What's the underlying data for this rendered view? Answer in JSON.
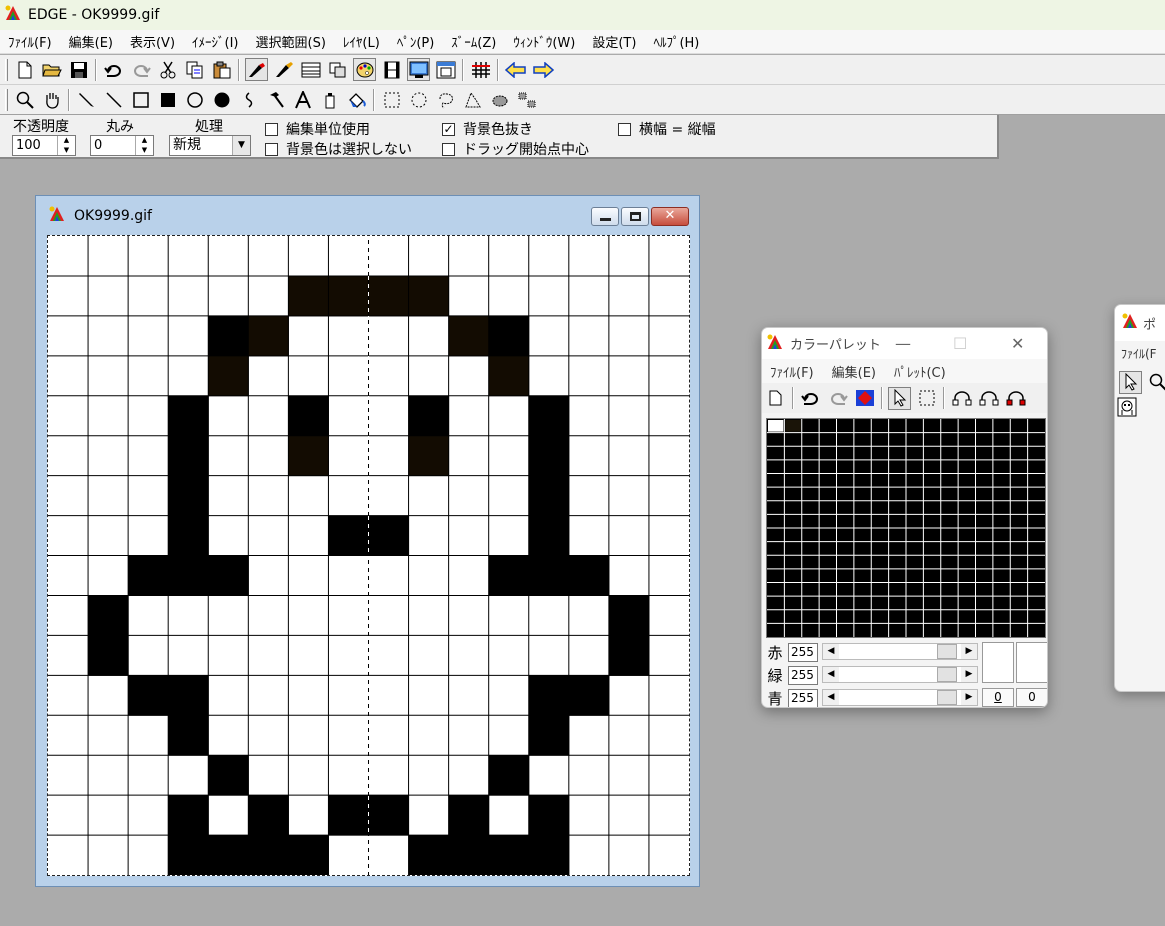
{
  "app": {
    "title": "EDGE - OK9999.gif"
  },
  "menu": {
    "file": "ﾌｧｲﾙ(F)",
    "edit": "編集(E)",
    "view": "表示(V)",
    "image": "ｲﾒｰｼﾞ(I)",
    "selection": "選択範囲(S)",
    "layer": "ﾚｲﾔ(L)",
    "pen": "ﾍﾟﾝ(P)",
    "zoom": "ｽﾞｰﾑ(Z)",
    "window": "ｳｨﾝﾄﾞｳ(W)",
    "settings": "設定(T)",
    "help": "ﾍﾙﾌﾟ(H)"
  },
  "options": {
    "opacity_label": "不透明度",
    "opacity_value": "100",
    "roundness_label": "丸み",
    "roundness_value": "0",
    "process_label": "処理",
    "process_value": "新規",
    "cb_edit_unit": {
      "label": "編集単位使用",
      "checked": false
    },
    "cb_bg_not_selected": {
      "label": "背景色は選択しない",
      "checked": false
    },
    "cb_bg_transparent": {
      "label": "背景色抜き",
      "checked": true
    },
    "cb_drag_center": {
      "label": "ドラッグ開始点中心",
      "checked": false
    },
    "cb_aspect": {
      "label": "横幅 = 縦幅",
      "checked": false
    }
  },
  "image_window": {
    "title": "OK9999.gif",
    "grid_cols": 16,
    "grid_rows": 16,
    "grid_color": "#000000",
    "ink_color": "#000000",
    "dark_ink_color": "#130c02",
    "pixels": [
      "................",
      "......dddd......",
      "....#d....d#....",
      "....d......d....",
      "...#..#..#..#...",
      "...#..d..d..#...",
      "...#........#...",
      "...#...##...#...",
      "..###......###..",
      ".#............#.",
      ".#............#.",
      "..##........##..",
      "...#........#...",
      "....#......#....",
      "...#.#.##.#.#...",
      "...####..####..."
    ]
  },
  "palette_window": {
    "title": "カラーパレット",
    "menu_file": "ﾌｧｲﾙ(F)",
    "menu_edit": "編集(E)",
    "menu_palette": "ﾊﾟﾚｯﾄ(C)",
    "grid_cols": 16,
    "grid_rows": 16,
    "selected_color": "#ffffff",
    "second_color": "#1a1408",
    "red_label": "赤",
    "green_label": "緑",
    "blue_label": "青",
    "red_value": "255",
    "green_value": "255",
    "blue_value": "255",
    "index_left": "0",
    "index_right": "0"
  },
  "third_window": {
    "title": "ポ",
    "menu_file": "ﾌｧｲﾙ(F"
  }
}
